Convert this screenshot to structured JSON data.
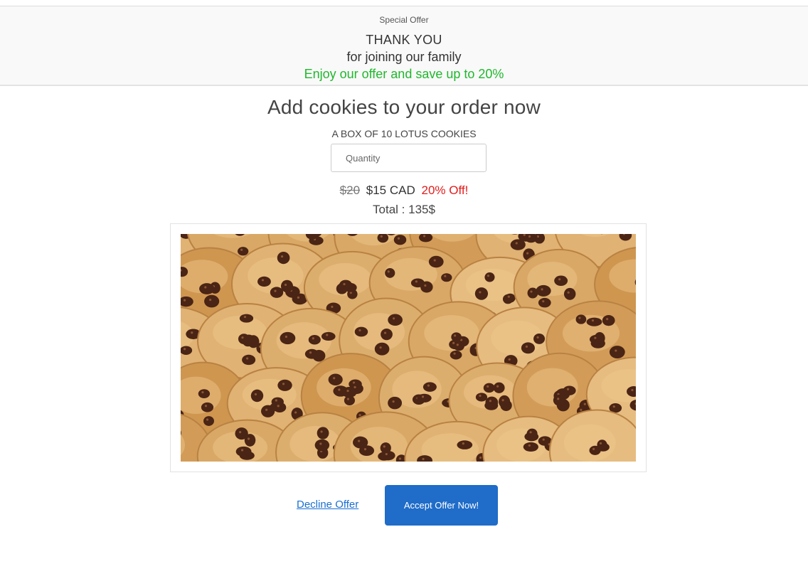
{
  "banner": {
    "label": "Special Offer",
    "thanks": "THANK YOU",
    "joining": "for joining our family",
    "enjoy": "Enjoy our offer and save up to 20%"
  },
  "main": {
    "headline": "Add cookies to your order now",
    "product_name": "A BOX OF 10 LOTUS COOKIES",
    "quantity_placeholder": "Quantity",
    "quantity_value": "",
    "old_price": "$20",
    "new_price": "$15 CAD",
    "discount": "20% Off!",
    "total": "Total : 135$"
  },
  "actions": {
    "decline_label": "Decline Offer",
    "accept_label": "Accept Offer Now!"
  },
  "colors": {
    "accent_green": "#1fb82c",
    "discount_red": "#e41b1b",
    "button_blue": "#1f6cc9",
    "link_blue": "#1a6fd1"
  }
}
